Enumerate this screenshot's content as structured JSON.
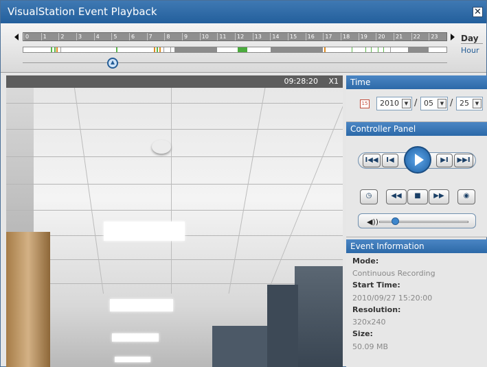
{
  "window": {
    "title": "VisualStation Event Playback",
    "close_label": "✕"
  },
  "timeline": {
    "hours": [
      "0",
      "1",
      "2",
      "3",
      "4",
      "5",
      "6",
      "7",
      "8",
      "9",
      "10",
      "11",
      "12",
      "13",
      "14",
      "15",
      "16",
      "17",
      "18",
      "19",
      "20",
      "21",
      "22",
      "23"
    ],
    "mode_day": "Day",
    "mode_hour": "Hour",
    "slider_position_hour": 5.1
  },
  "video": {
    "time": "09:28:20",
    "speed": "X1"
  },
  "time_panel": {
    "header": "Time",
    "calendar_icon_label": "15",
    "year": "2010",
    "month": "05",
    "day": "25",
    "separator": "/"
  },
  "controller": {
    "header": "Controller Panel",
    "buttons": {
      "first": "I◀◀",
      "prev": "I◀",
      "next": "▶I",
      "last": "▶▶I",
      "rewind": "◀◀",
      "stop": "■",
      "forward": "▶▶"
    },
    "volume_level": 0.18
  },
  "event_info": {
    "header": "Event Information",
    "mode_label": "Mode:",
    "mode_value": "Continuous Recording",
    "start_label": "Start Time:",
    "start_value": "2010/09/27 15:20:00",
    "resolution_label": "Resolution:",
    "resolution_value": "320x240",
    "size_label": "Size:",
    "size_value": "50.09 MB"
  }
}
